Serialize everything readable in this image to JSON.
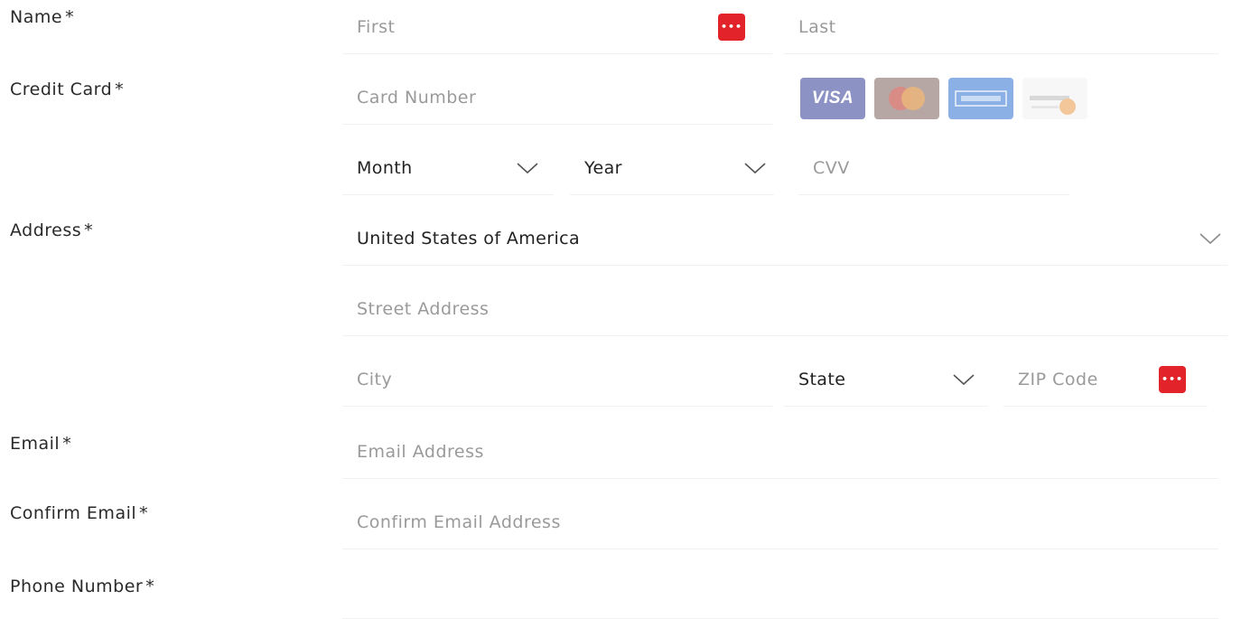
{
  "labels": {
    "name": "Name",
    "credit_card": "Credit Card",
    "address": "Address",
    "email": "Email",
    "confirm_email": "Confirm Email",
    "phone": "Phone Number",
    "required_marker": "*"
  },
  "name_fields": {
    "first_placeholder": "First",
    "last_placeholder": "Last"
  },
  "card_fields": {
    "number_placeholder": "Card Number",
    "month_value": "Month",
    "year_value": "Year",
    "cvv_placeholder": "CVV",
    "card_brands": [
      {
        "brand": "VISA",
        "icon": "visa-icon",
        "color": "#8d92c4"
      },
      {
        "brand": "Mastercard",
        "icon": "mastercard-icon",
        "color": "#b7a7a4"
      },
      {
        "brand": "AMEX",
        "icon": "amex-icon",
        "color": "#8bb0e6"
      },
      {
        "brand": "Discover",
        "icon": "discover-icon",
        "color": "#f7f7f7"
      }
    ]
  },
  "address_fields": {
    "country_value": "United States of America",
    "street_placeholder": "Street Address",
    "city_placeholder": "City",
    "state_value": "State",
    "zip_placeholder": "ZIP Code"
  },
  "email_fields": {
    "email_placeholder": "Email Address",
    "confirm_placeholder": "Confirm Email Address"
  },
  "colors": {
    "password_manager_icon": "#e2232a",
    "placeholder_text": "#9a9a9a",
    "value_text": "#222222"
  },
  "icons": {
    "password_manager": "password-manager-icon",
    "dropdown": "chevron-down-icon"
  }
}
